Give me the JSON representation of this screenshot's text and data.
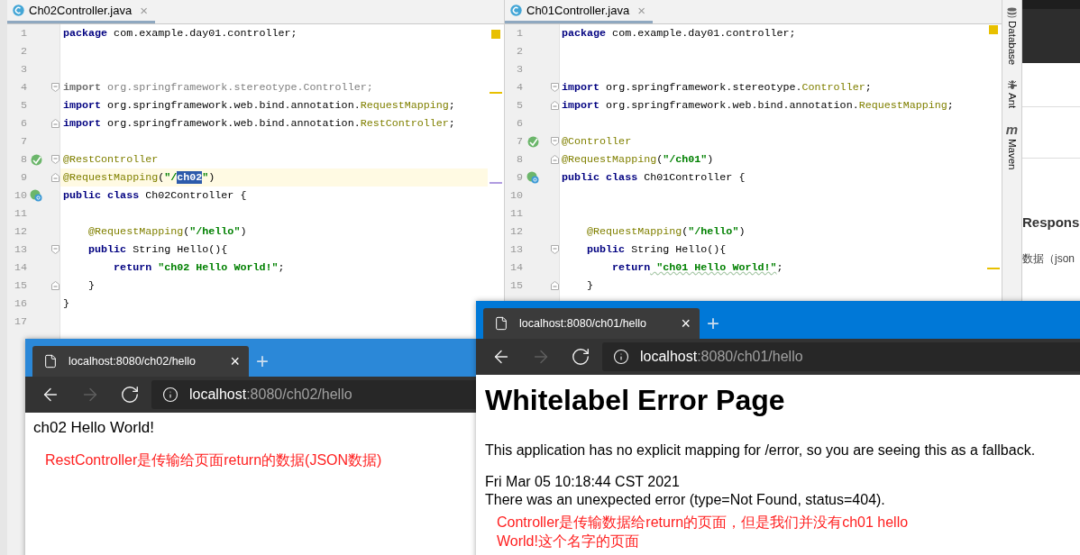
{
  "editors": [
    {
      "tab": {
        "title": "Ch02Controller.java",
        "close": "×"
      },
      "lines": [
        {
          "num": "1",
          "tokens": [
            {
              "kind": "kw",
              "text": "package"
            },
            {
              "kind": "p",
              "text": " com.example.day01.controller;"
            }
          ]
        },
        {
          "num": "2"
        },
        {
          "num": "3"
        },
        {
          "num": "4",
          "fold_start": true,
          "tokens": [
            {
              "kind": "unusedkw",
              "text": "import"
            },
            {
              "kind": "unused",
              "text": " org.springframework.stereotype.Controller;"
            }
          ]
        },
        {
          "num": "5",
          "tokens": [
            {
              "kind": "kw",
              "text": "import"
            },
            {
              "kind": "p",
              "text": " org.springframework.web.bind.annotation."
            },
            {
              "kind": "ann",
              "text": "RequestMapping"
            },
            {
              "kind": "p",
              "text": ";"
            }
          ]
        },
        {
          "num": "6",
          "fold_end": true,
          "tokens": [
            {
              "kind": "kw",
              "text": "import"
            },
            {
              "kind": "p",
              "text": " org.springframework.web.bind.annotation."
            },
            {
              "kind": "ann",
              "text": "RestController"
            },
            {
              "kind": "p",
              "text": ";"
            }
          ]
        },
        {
          "num": "7"
        },
        {
          "num": "8",
          "gutter": {
            "kind": "bean"
          },
          "fold_start": true,
          "tokens": [
            {
              "kind": "ann",
              "text": "@RestController"
            }
          ]
        },
        {
          "num": "9",
          "current": true,
          "fold_end": true,
          "tokens": [
            {
              "kind": "ann",
              "text": "@RequestMapping"
            },
            {
              "kind": "p",
              "text": "("
            },
            {
              "kind": "str",
              "text": "\"/"
            },
            {
              "kind": "sel",
              "text": "ch02"
            },
            {
              "kind": "str",
              "text": "\""
            },
            {
              "kind": "p",
              "text": ")"
            }
          ]
        },
        {
          "num": "10",
          "gutter": {
            "kind": "class"
          },
          "tokens": [
            {
              "kind": "kw",
              "text": "public class"
            },
            {
              "kind": "p",
              "text": " Ch02Controller {"
            }
          ]
        },
        {
          "num": "11"
        },
        {
          "num": "12",
          "tokens": [
            {
              "kind": "ann",
              "text": "    @RequestMapping"
            },
            {
              "kind": "p",
              "text": "("
            },
            {
              "kind": "str",
              "text": "\"/hello\""
            },
            {
              "kind": "p",
              "text": ")"
            }
          ]
        },
        {
          "num": "13",
          "fold_start": true,
          "tokens": [
            {
              "kind": "kw",
              "text": "    public"
            },
            {
              "kind": "p",
              "text": " String Hello(){"
            }
          ]
        },
        {
          "num": "14",
          "tokens": [
            {
              "kind": "kw",
              "text": "        return"
            },
            {
              "kind": "str",
              "text": " \"ch02 Hello World!\""
            },
            {
              "kind": "p",
              "text": ";"
            }
          ]
        },
        {
          "num": "15",
          "fold_end": true,
          "tokens": [
            {
              "kind": "p",
              "text": "    }"
            }
          ]
        },
        {
          "num": "16",
          "tokens": [
            {
              "kind": "p",
              "text": "}"
            }
          ]
        },
        {
          "num": "17"
        }
      ]
    },
    {
      "tab": {
        "title": "Ch01Controller.java",
        "close": "×"
      },
      "lines": [
        {
          "num": "1",
          "tokens": [
            {
              "kind": "kw",
              "text": "package"
            },
            {
              "kind": "p",
              "text": " com.example.day01.controller;"
            }
          ]
        },
        {
          "num": "2"
        },
        {
          "num": "3"
        },
        {
          "num": "4",
          "fold_start": true,
          "tokens": [
            {
              "kind": "kw",
              "text": "import"
            },
            {
              "kind": "p",
              "text": " org.springframework.stereotype."
            },
            {
              "kind": "ann",
              "text": "Controller"
            },
            {
              "kind": "p",
              "text": ";"
            }
          ]
        },
        {
          "num": "5",
          "fold_end": true,
          "tokens": [
            {
              "kind": "kw",
              "text": "import"
            },
            {
              "kind": "p",
              "text": " org.springframework.web.bind.annotation."
            },
            {
              "kind": "ann",
              "text": "RequestMapping"
            },
            {
              "kind": "p",
              "text": ";"
            }
          ]
        },
        {
          "num": "6"
        },
        {
          "num": "7",
          "gutter": {
            "kind": "bean"
          },
          "fold_start": true,
          "tokens": [
            {
              "kind": "ann",
              "text": "@Controller"
            }
          ]
        },
        {
          "num": "8",
          "fold_end": true,
          "tokens": [
            {
              "kind": "ann",
              "text": "@RequestMapping"
            },
            {
              "kind": "p",
              "text": "("
            },
            {
              "kind": "str",
              "text": "\"/ch01\""
            },
            {
              "kind": "p",
              "text": ")"
            }
          ]
        },
        {
          "num": "9",
          "gutter": {
            "kind": "class"
          },
          "tokens": [
            {
              "kind": "kw",
              "text": "public class"
            },
            {
              "kind": "p",
              "text": " Ch01Controller {"
            }
          ]
        },
        {
          "num": "10"
        },
        {
          "num": "11"
        },
        {
          "num": "12",
          "tokens": [
            {
              "kind": "ann",
              "text": "    @RequestMapping"
            },
            {
              "kind": "p",
              "text": "("
            },
            {
              "kind": "str",
              "text": "\"/hello\""
            },
            {
              "kind": "p",
              "text": ")"
            }
          ]
        },
        {
          "num": "13",
          "fold_start": true,
          "tokens": [
            {
              "kind": "kw",
              "text": "    public"
            },
            {
              "kind": "p",
              "text": " String Hello(){"
            }
          ]
        },
        {
          "num": "14",
          "tokens": [
            {
              "kind": "kw",
              "text": "        return"
            },
            {
              "kind": "typo",
              "text": " \"ch01 Hello World!\""
            },
            {
              "kind": "p",
              "text": ";"
            }
          ]
        },
        {
          "num": "15",
          "fold_end": true,
          "tokens": [
            {
              "kind": "p",
              "text": "    }"
            }
          ]
        }
      ]
    }
  ],
  "tool_strip": [
    {
      "kind": "database",
      "label": "Database"
    },
    {
      "kind": "ant",
      "label": "Ant"
    },
    {
      "kind": "maven",
      "label": "Maven",
      "glyph": "m"
    }
  ],
  "background_page": {
    "heading": "Respons",
    "text": "数据（json"
  },
  "browsers": [
    {
      "focused": false,
      "tab": {
        "title": "localhost:8080/ch02/hello",
        "close": "×"
      },
      "new_tab": "+",
      "nav": [
        {
          "kind": "back",
          "disabled": false
        },
        {
          "kind": "forward",
          "disabled": true
        },
        {
          "kind": "reload",
          "disabled": false
        }
      ],
      "address": {
        "host": "localhost",
        "path": ":8080/ch02/hello"
      },
      "content": [
        {
          "kind": "text",
          "text": "ch02 Hello World!"
        },
        {
          "kind": "note",
          "text": "RestController是传输给页面return的数据(JSON数据)"
        }
      ]
    },
    {
      "focused": true,
      "tab": {
        "title": "localhost:8080/ch01/hello",
        "close": "×"
      },
      "new_tab": "+",
      "nav": [
        {
          "kind": "back",
          "disabled": false
        },
        {
          "kind": "forward",
          "disabled": true
        },
        {
          "kind": "reload",
          "disabled": false
        }
      ],
      "address": {
        "host": "localhost",
        "path": ":8080/ch01/hello"
      },
      "content": [
        {
          "kind": "heading",
          "text": "Whitelabel Error Page"
        },
        {
          "kind": "paragraph",
          "text": "This application has no explicit mapping for /error, so you are seeing this as a fallback."
        },
        {
          "kind": "line",
          "text": "Fri Mar 05 10:18:44 CST 2021"
        },
        {
          "kind": "line",
          "text": "There was an unexpected error (type=Not Found, status=404)."
        },
        {
          "kind": "note",
          "text": "Controller是传输数据给return的页面，但是我们并没有ch01 hello World!这个名字的页面"
        }
      ]
    }
  ]
}
